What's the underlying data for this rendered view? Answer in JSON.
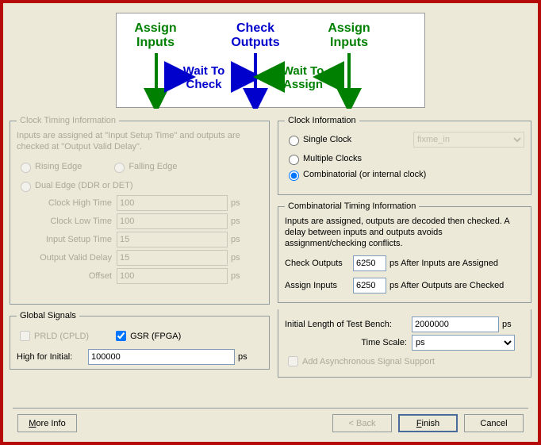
{
  "diagram": {
    "l1": "Assign\nInputs",
    "l2": "Check\nOutputs",
    "l3": "Assign\nInputs",
    "wait1": "Wait To\nCheck",
    "wait2": "Wait To\nAssign"
  },
  "cti": {
    "legend": "Clock Timing Information",
    "desc": "Inputs are assigned at \"Input Setup Time\" and outputs are checked at \"Output Valid Delay\".",
    "rising": "Rising Edge",
    "falling": "Falling Edge",
    "dual": "Dual Edge (DDR or DET)",
    "cht": "Clock High Time",
    "cht_v": "100",
    "clt": "Clock Low Time",
    "clt_v": "100",
    "ist": "Input Setup Time",
    "ist_v": "15",
    "ovd": "Output Valid Delay",
    "ovd_v": "15",
    "off": "Offset",
    "off_v": "100",
    "ps": "ps"
  },
  "ci": {
    "legend": "Clock Information",
    "single": "Single Clock",
    "single_sel": "fixme_in",
    "multi": "Multiple Clocks",
    "comb": "Combinatorial (or internal clock)"
  },
  "comb": {
    "legend": "Combinatorial Timing Information",
    "desc": "Inputs are assigned, outputs are decoded then checked.  A delay between inputs and outputs avoids assignment/checking conflicts.",
    "co": "Check Outputs",
    "co_v": "6250",
    "co_after": "ps  After Inputs are Assigned",
    "ai": "Assign Inputs",
    "ai_v": "6250",
    "ai_after": "ps  After Outputs are Checked"
  },
  "gs": {
    "legend": "Global Signals",
    "prld": "PRLD (CPLD)",
    "gsr": "GSR (FPGA)",
    "high": "High for Initial:",
    "high_v": "100000",
    "ps": "ps"
  },
  "other": {
    "initlen": "Initial Length of Test Bench:",
    "initlen_v": "2000000",
    "initlen_u": "ps",
    "ts": "Time Scale:",
    "ts_v": "ps",
    "async": "Add Asynchronous Signal Support"
  },
  "btns": {
    "more": "More Info",
    "back": "< Back",
    "finish": "Finish",
    "cancel": "Cancel"
  }
}
